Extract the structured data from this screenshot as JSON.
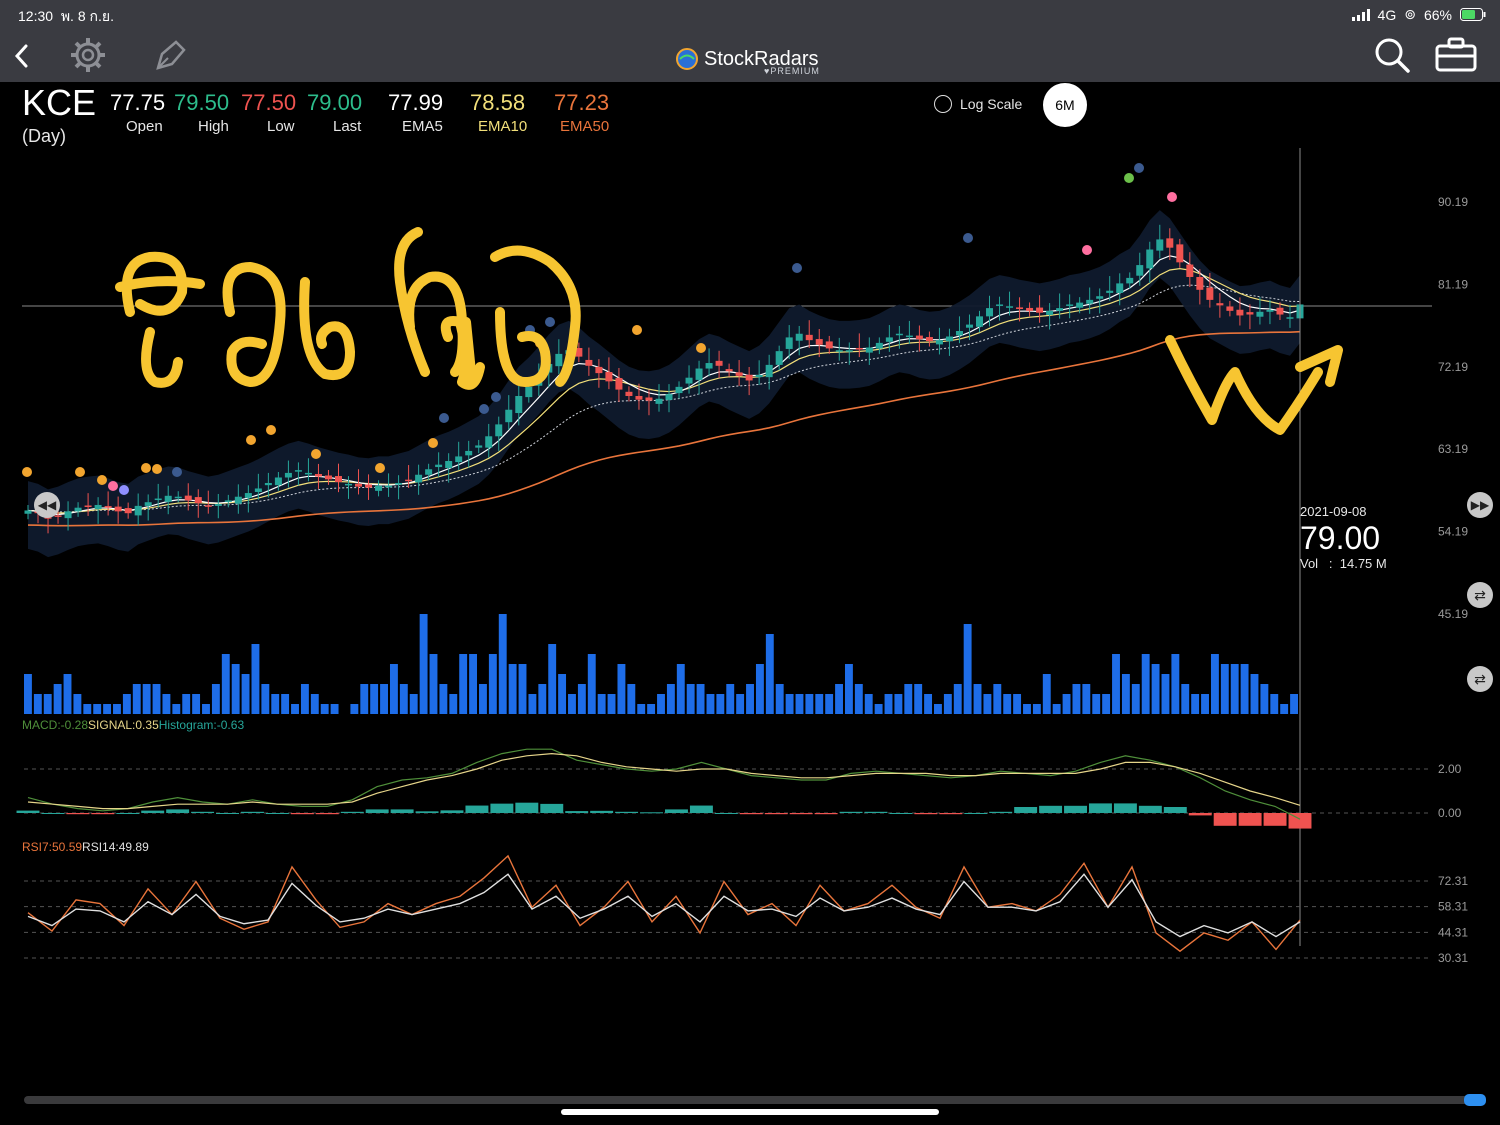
{
  "status_bar": {
    "time": "12:30",
    "date": "พ. 8 ก.ย.",
    "network": "4G",
    "battery": "66%"
  },
  "nav": {
    "back_icon": "chevron-left-icon",
    "settings_icon": "gear-icon",
    "draw_icon": "pen-icon",
    "brand": "StockRadars",
    "brand_sub": "PREMIUM",
    "search_icon": "search-icon",
    "portfolio_icon": "briefcase-icon"
  },
  "quote": {
    "symbol": "KCE",
    "period": "(Day)",
    "open": "77.75",
    "high": "79.50",
    "low": "77.50",
    "last": "79.00",
    "ema5": "77.99",
    "ema10": "78.58",
    "ema50": "77.23",
    "labels": {
      "open": "Open",
      "high": "High",
      "low": "Low",
      "last": "Last",
      "ema5": "EMA5",
      "ema10": "EMA10",
      "ema50": "EMA50"
    }
  },
  "controls": {
    "log_scale_label": "Log Scale",
    "range": "6M"
  },
  "crosshair": {
    "date": "2021-09-08",
    "price": "79.00",
    "vol_label": "Vol",
    "vol_value": "14.75 M"
  },
  "macd_label": {
    "macd": "MACD:-0.28",
    "signal": "SIGNAL:0.35",
    "hist": "Histogram:-0.63"
  },
  "rsi_label": {
    "rsi7": "RSI7:50.59",
    "rsi14": "RSI14:49.89"
  },
  "colors": {
    "up": "#26a69a",
    "down": "#ef5350",
    "volume": "#1e6de8",
    "ema5": "#ffffff",
    "ema10": "#f2df7a",
    "ema50": "#e8743b",
    "macd": "#4f8f3a",
    "signal": "#e6d58a",
    "rsi7": "#e8743b",
    "rsi14": "#e0e0e0",
    "annotation": "#f7c531"
  },
  "chart_data": [
    {
      "type": "candlestick",
      "title": "KCE (Day)",
      "y_ticks": [
        "90.19",
        "81.19",
        "72.19",
        "63.19",
        "54.19",
        "45.19"
      ],
      "ylim": [
        45.19,
        90.19
      ],
      "close_approx": [
        56.5,
        56.2,
        55.6,
        55.9,
        56.4,
        56.8,
        57.0,
        57.1,
        56.8,
        56.4,
        56.2,
        57.0,
        57.4,
        57.8,
        58.1,
        58.0,
        57.6,
        57.3,
        57.0,
        57.2,
        57.6,
        58.0,
        58.4,
        58.9,
        59.5,
        60.1,
        60.6,
        60.9,
        60.6,
        60.2,
        59.9,
        59.6,
        59.4,
        59.1,
        59.0,
        59.2,
        59.2,
        59.5,
        59.8,
        60.4,
        61.0,
        61.5,
        61.9,
        62.4,
        63.0,
        63.6,
        64.6,
        65.9,
        67.5,
        69.0,
        70.0,
        71.2,
        72.5,
        73.6,
        74.0,
        73.3,
        72.3,
        71.5,
        70.6,
        69.7,
        69.0,
        68.6,
        68.5,
        68.7,
        69.2,
        70.0,
        71.0,
        72.0,
        72.6,
        72.3,
        71.7,
        71.2,
        70.7,
        71.3,
        72.4,
        73.9,
        75.4,
        75.8,
        75.1,
        74.6,
        74.2,
        74.0,
        74.0,
        74.1,
        74.3,
        74.8,
        75.4,
        75.8,
        75.6,
        75.2,
        75.0,
        75.1,
        75.5,
        76.1,
        76.8,
        77.7,
        78.6,
        79.0,
        78.8,
        78.5,
        78.3,
        78.1,
        78.3,
        78.6,
        79.0,
        79.2,
        79.5,
        79.9,
        80.5,
        81.3,
        81.9,
        83.3,
        85.0,
        86.1,
        85.2,
        83.6,
        82.0,
        80.6,
        79.5,
        78.9,
        78.3,
        77.8,
        77.9,
        78.2,
        78.4,
        77.9,
        77.6,
        79.0
      ]
    },
    {
      "type": "bar",
      "title": "Volume",
      "values_relative": [
        4,
        2,
        2,
        3,
        4,
        2,
        1,
        1,
        1,
        1,
        2,
        3,
        3,
        3,
        2,
        1,
        2,
        2,
        1,
        3,
        6,
        5,
        4,
        7,
        3,
        2,
        2,
        1,
        3,
        2,
        1,
        1,
        0,
        1,
        3,
        3,
        3,
        5,
        3,
        2,
        10,
        6,
        3,
        2,
        6,
        6,
        3,
        6,
        10,
        5,
        5,
        2,
        3,
        7,
        4,
        2,
        3,
        6,
        2,
        2,
        5,
        3,
        1,
        1,
        2,
        3,
        5,
        3,
        3,
        2,
        2,
        3,
        2,
        3,
        5,
        8,
        3,
        2,
        2,
        2,
        2,
        2,
        3,
        5,
        3,
        2,
        1,
        2,
        2,
        3,
        3,
        2,
        1,
        2,
        3,
        9,
        3,
        2,
        3,
        2,
        2,
        1,
        1,
        4,
        1,
        2,
        3,
        3,
        2,
        2,
        6,
        4,
        3,
        6,
        5,
        4,
        6,
        3,
        2,
        2,
        6,
        5,
        5,
        5,
        4,
        3,
        2,
        1,
        2
      ]
    },
    {
      "type": "line",
      "title": "MACD",
      "y_ticks": [
        "2.00",
        "0.00"
      ],
      "series": [
        {
          "name": "MACD",
          "values": [
            0.7,
            0.4,
            0.2,
            0.1,
            0.2,
            0.5,
            0.7,
            0.5,
            0.4,
            0.6,
            0.4,
            0.3,
            0.3,
            0.6,
            1.2,
            1.5,
            1.6,
            1.8,
            2.3,
            2.7,
            2.9,
            2.9,
            2.4,
            2.2,
            2.0,
            1.9,
            2.0,
            2.3,
            2.0,
            1.7,
            1.6,
            1.5,
            1.5,
            1.8,
            1.9,
            1.8,
            1.7,
            1.6,
            1.7,
            1.9,
            1.8,
            1.7,
            1.9,
            2.3,
            2.6,
            2.4,
            2.1,
            1.6,
            1.0,
            0.6,
            0.3,
            -0.28
          ]
        },
        {
          "name": "SIGNAL",
          "values": [
            0.5,
            0.4,
            0.3,
            0.2,
            0.2,
            0.3,
            0.4,
            0.4,
            0.4,
            0.5,
            0.4,
            0.4,
            0.4,
            0.5,
            0.9,
            1.2,
            1.5,
            1.7,
            2.0,
            2.4,
            2.6,
            2.7,
            2.6,
            2.3,
            2.1,
            2.0,
            1.9,
            2.0,
            2.0,
            1.8,
            1.7,
            1.6,
            1.6,
            1.7,
            1.8,
            1.8,
            1.8,
            1.7,
            1.7,
            1.8,
            1.8,
            1.8,
            1.8,
            2.0,
            2.3,
            2.3,
            2.1,
            1.8,
            1.4,
            1.0,
            0.7,
            0.35
          ]
        }
      ]
    },
    {
      "type": "line",
      "title": "RSI",
      "y_ticks": [
        "72.31",
        "58.31",
        "44.31",
        "30.31"
      ],
      "series": [
        {
          "name": "RSI7",
          "values": [
            55,
            45,
            62,
            60,
            48,
            68,
            54,
            72,
            52,
            46,
            50,
            80,
            62,
            47,
            50,
            60,
            54,
            60,
            64,
            74,
            86,
            58,
            70,
            48,
            58,
            72,
            50,
            64,
            44,
            72,
            54,
            60,
            48,
            70,
            56,
            60,
            70,
            58,
            52,
            80,
            58,
            60,
            56,
            65,
            82,
            58,
            80,
            44,
            34,
            44,
            40,
            50,
            35,
            51
          ]
        },
        {
          "name": "RSI14",
          "values": [
            53,
            48,
            57,
            56,
            50,
            61,
            54,
            65,
            53,
            49,
            51,
            71,
            59,
            50,
            52,
            57,
            54,
            57,
            60,
            66,
            76,
            57,
            64,
            52,
            57,
            64,
            53,
            60,
            50,
            64,
            56,
            57,
            53,
            63,
            56,
            58,
            63,
            57,
            54,
            72,
            58,
            58,
            56,
            61,
            76,
            58,
            73,
            50,
            42,
            48,
            44,
            50,
            42,
            50
          ]
        }
      ]
    }
  ]
}
